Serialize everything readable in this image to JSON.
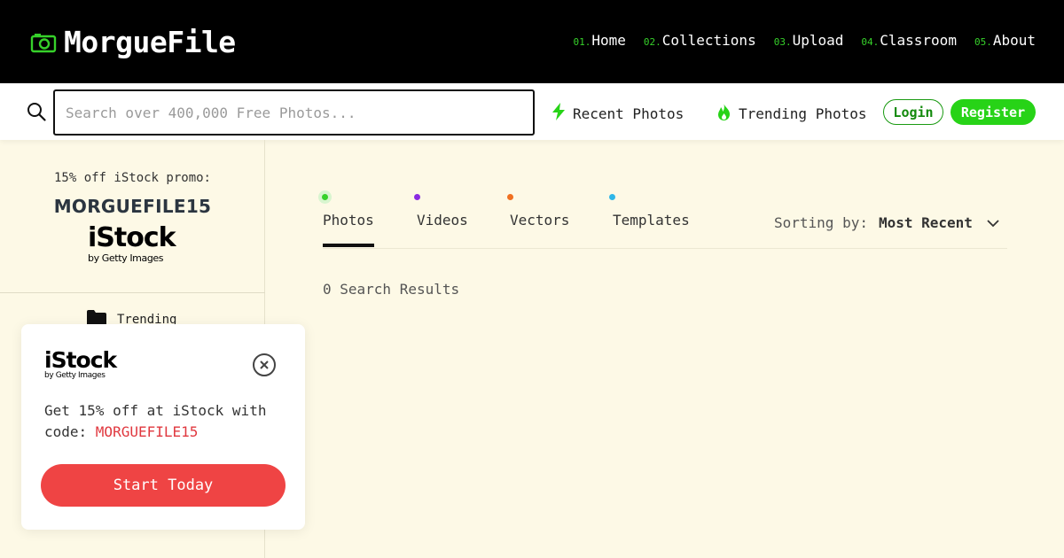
{
  "header": {
    "logo_text": "MorgueFile",
    "logo_icon": "camera-icon",
    "nav": [
      {
        "num": "01.",
        "label": "Home"
      },
      {
        "num": "02.",
        "label": "Collections"
      },
      {
        "num": "03.",
        "label": "Upload"
      },
      {
        "num": "04.",
        "label": "Classroom"
      },
      {
        "num": "05.",
        "label": "About"
      }
    ]
  },
  "search": {
    "icon": "search-icon",
    "placeholder": "Search over 400,000 Free Photos...",
    "value": ""
  },
  "quick_links": {
    "recent": "Recent Photos",
    "trending": "Trending Photos"
  },
  "auth": {
    "login": "Login",
    "register": "Register"
  },
  "sidebar": {
    "promo_label": "15% off iStock promo:",
    "promo_code": "MORGUEFILE15",
    "istock_word": "iStock",
    "istock_sub": "by Getty Images",
    "trending_label": "Trending"
  },
  "tabs": [
    {
      "label": "Photos",
      "dot_color": "#36d12a",
      "active": true
    },
    {
      "label": "Videos",
      "dot_color": "#8a2be2",
      "active": false
    },
    {
      "label": "Vectors",
      "dot_color": "#f07020",
      "active": false
    },
    {
      "label": "Templates",
      "dot_color": "#2fb6e8",
      "active": false
    }
  ],
  "sorting": {
    "label": "Sorting by:",
    "value": "Most Recent"
  },
  "results": "0 Search Results",
  "popup": {
    "istock_word": "iStock",
    "istock_sub": "by Getty Images",
    "text": "Get 15% off at iStock with code: ",
    "code": "MORGUEFILE15",
    "button": "Start Today"
  },
  "colors": {
    "accent_green": "#27d317",
    "background": "#fdf9e6",
    "cta_red": "#ef4444"
  }
}
